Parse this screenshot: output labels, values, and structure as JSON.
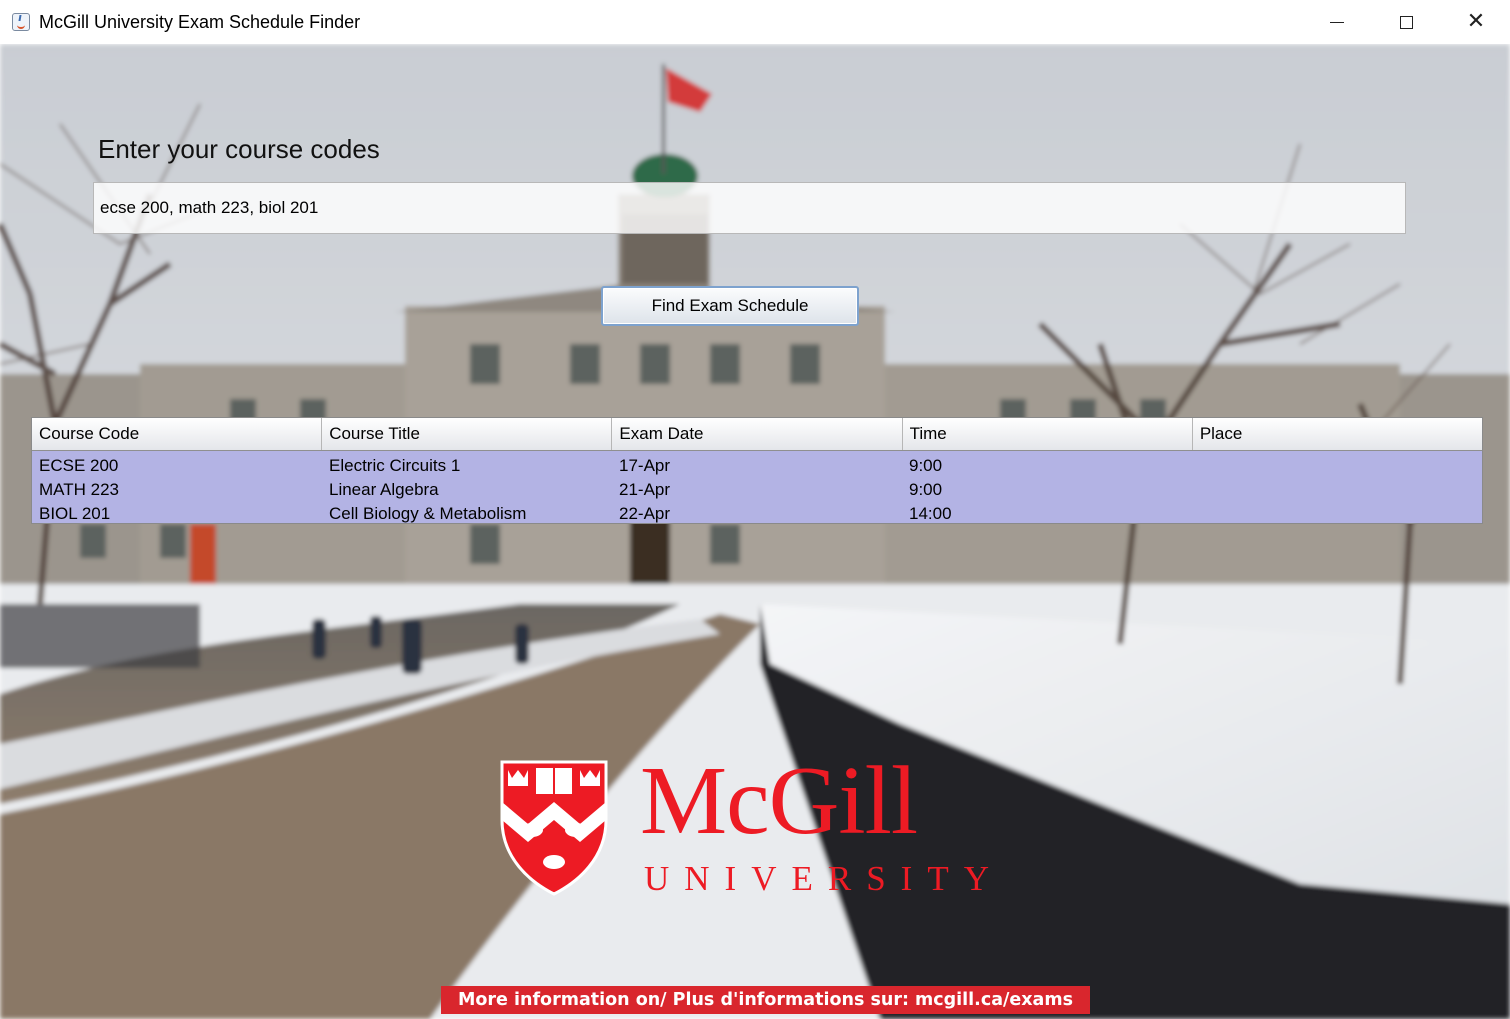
{
  "window": {
    "title": "McGill University Exam Schedule Finder",
    "controls": [
      "minimize-icon",
      "maximize-icon",
      "close-icon"
    ],
    "close_glyph": "✕"
  },
  "form": {
    "prompt": "Enter your course codes",
    "input_value": "ecse 200, math 223, biol 201",
    "button_label": "Find Exam Schedule"
  },
  "table": {
    "headers": [
      "Course Code",
      "Course Title",
      "Exam Date",
      "Time",
      "Place"
    ],
    "rows": [
      [
        "ECSE 200",
        "Electric Circuits 1",
        "17-Apr",
        "9:00",
        ""
      ],
      [
        "MATH 223",
        "Linear Algebra",
        "21-Apr",
        "9:00",
        ""
      ],
      [
        "BIOL 201",
        "Cell Biology & Metabolism",
        "22-Apr",
        "14:00",
        ""
      ]
    ],
    "selected_row_color": "#b3b3e4"
  },
  "logo": {
    "wordmark": "McGill",
    "subtitle": "UNIVERSITY",
    "color": "#ed1b24"
  },
  "footer": {
    "info_text": "More information on/ Plus d'informations sur: mcgill.ca/exams",
    "background_color": "#d9262d"
  }
}
